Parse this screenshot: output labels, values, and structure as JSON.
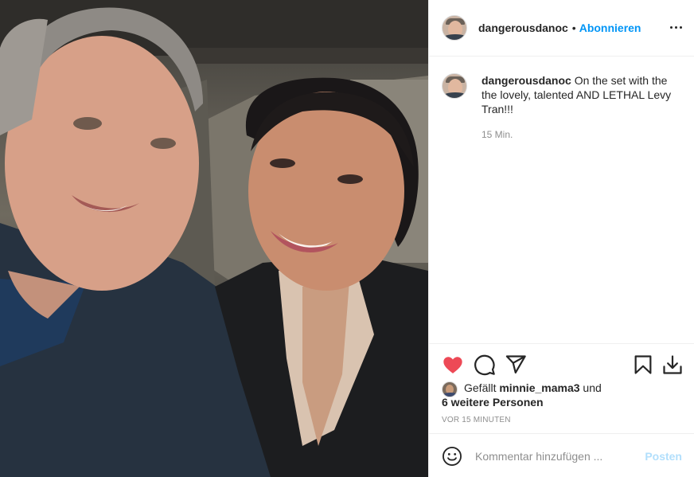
{
  "header": {
    "username": "dangerousdanoc",
    "separator": "•",
    "follow_label": "Abonnieren",
    "more_icon": "more-horizontal-icon"
  },
  "caption": {
    "username": "dangerousdanoc",
    "text": "On the set with the the lovely, talented AND LETHAL Levy Tran!!!",
    "time": "15 Min."
  },
  "actions": {
    "like_icon": "heart-icon",
    "like_color": "#ed4956",
    "comment_icon": "comment-icon",
    "share_icon": "paper-plane-icon",
    "save_icon": "bookmark-icon",
    "download_icon": "download-icon"
  },
  "likes": {
    "prefix": "Gefällt",
    "first_user": "minnie_mama3",
    "connector": "und",
    "others": "6 weitere Personen"
  },
  "timestamp": "VOR 15 MINUTEN",
  "add_comment": {
    "emoji_icon": "smiley-icon",
    "placeholder": "Kommentar hinzufügen ...",
    "post_label": "Posten",
    "post_color": "#b2dffc"
  },
  "colors": {
    "accent": "#0095f6",
    "text": "#262626",
    "muted": "#8e8e8e",
    "border": "#efefef"
  }
}
